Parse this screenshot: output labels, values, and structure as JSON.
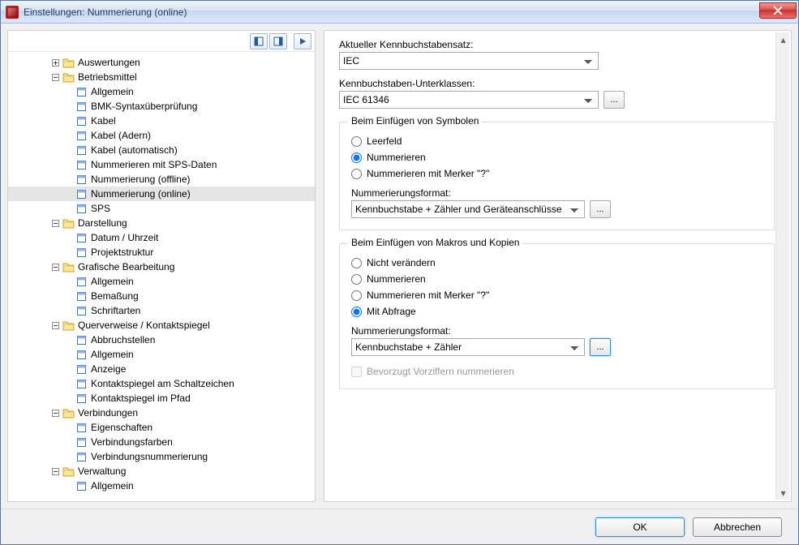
{
  "window": {
    "title": "Einstellungen: Nummerierung (online)"
  },
  "tree": {
    "items": [
      {
        "depth": 3,
        "toggle": "plus",
        "type": "folder",
        "label": "Auswertungen"
      },
      {
        "depth": 3,
        "toggle": "minus",
        "type": "folder",
        "label": "Betriebsmittel"
      },
      {
        "depth": 4,
        "toggle": "none",
        "type": "page",
        "label": "Allgemein"
      },
      {
        "depth": 4,
        "toggle": "none",
        "type": "page",
        "label": "BMK-Syntaxüberprüfung"
      },
      {
        "depth": 4,
        "toggle": "none",
        "type": "page",
        "label": "Kabel"
      },
      {
        "depth": 4,
        "toggle": "none",
        "type": "page",
        "label": "Kabel (Adern)"
      },
      {
        "depth": 4,
        "toggle": "none",
        "type": "page",
        "label": "Kabel (automatisch)"
      },
      {
        "depth": 4,
        "toggle": "none",
        "type": "page",
        "label": "Nummerieren mit SPS-Daten"
      },
      {
        "depth": 4,
        "toggle": "none",
        "type": "page",
        "label": "Nummerierung (offline)"
      },
      {
        "depth": 4,
        "toggle": "none",
        "type": "page",
        "label": "Nummerierung (online)",
        "selected": true
      },
      {
        "depth": 4,
        "toggle": "none",
        "type": "page",
        "label": "SPS"
      },
      {
        "depth": 3,
        "toggle": "minus",
        "type": "folder",
        "label": "Darstellung"
      },
      {
        "depth": 4,
        "toggle": "none",
        "type": "page",
        "label": "Datum / Uhrzeit"
      },
      {
        "depth": 4,
        "toggle": "none",
        "type": "page",
        "label": "Projektstruktur"
      },
      {
        "depth": 3,
        "toggle": "minus",
        "type": "folder",
        "label": "Grafische Bearbeitung"
      },
      {
        "depth": 4,
        "toggle": "none",
        "type": "page",
        "label": "Allgemein"
      },
      {
        "depth": 4,
        "toggle": "none",
        "type": "page",
        "label": "Bemaßung"
      },
      {
        "depth": 4,
        "toggle": "none",
        "type": "page",
        "label": "Schriftarten"
      },
      {
        "depth": 3,
        "toggle": "minus",
        "type": "folder",
        "label": "Querverweise / Kontaktspiegel"
      },
      {
        "depth": 4,
        "toggle": "none",
        "type": "page",
        "label": "Abbruchstellen"
      },
      {
        "depth": 4,
        "toggle": "none",
        "type": "page",
        "label": "Allgemein"
      },
      {
        "depth": 4,
        "toggle": "none",
        "type": "page",
        "label": "Anzeige"
      },
      {
        "depth": 4,
        "toggle": "none",
        "type": "page",
        "label": "Kontaktspiegel am Schaltzeichen"
      },
      {
        "depth": 4,
        "toggle": "none",
        "type": "page",
        "label": "Kontaktspiegel im Pfad"
      },
      {
        "depth": 3,
        "toggle": "minus",
        "type": "folder",
        "label": "Verbindungen"
      },
      {
        "depth": 4,
        "toggle": "none",
        "type": "page",
        "label": "Eigenschaften"
      },
      {
        "depth": 4,
        "toggle": "none",
        "type": "page",
        "label": "Verbindungsfarben"
      },
      {
        "depth": 4,
        "toggle": "none",
        "type": "page",
        "label": "Verbindungsnummerierung"
      },
      {
        "depth": 3,
        "toggle": "minus",
        "type": "folder",
        "label": "Verwaltung"
      },
      {
        "depth": 4,
        "toggle": "none",
        "type": "page",
        "label": "Allgemein"
      }
    ]
  },
  "form": {
    "charset_label": "Aktueller Kennbuchstabensatz:",
    "charset_value": "IEC",
    "subclass_label": "Kennbuchstaben-Unterklassen:",
    "subclass_value": "IEC 61346",
    "ellipsis": "...",
    "group1": {
      "legend": "Beim Einfügen von Symbolen",
      "opt_empty": "Leerfeld",
      "opt_number": "Nummerieren",
      "opt_marker": "Nummerieren mit Merker \"?\"",
      "format_label": "Nummerierungsformat:",
      "format_value": "Kennbuchstabe + Zähler und Geräteanschlüsse"
    },
    "group2": {
      "legend": "Beim Einfügen von Makros und Kopien",
      "opt_keep": "Nicht verändern",
      "opt_number": "Nummerieren",
      "opt_marker": "Nummerieren mit Merker \"?\"",
      "opt_prompt": "Mit Abfrage",
      "format_label": "Nummerierungsformat:",
      "format_value": "Kennbuchstabe + Zähler",
      "checkbox": "Bevorzugt Vorziffern nummerieren"
    }
  },
  "footer": {
    "ok": "OK",
    "cancel": "Abbrechen"
  }
}
